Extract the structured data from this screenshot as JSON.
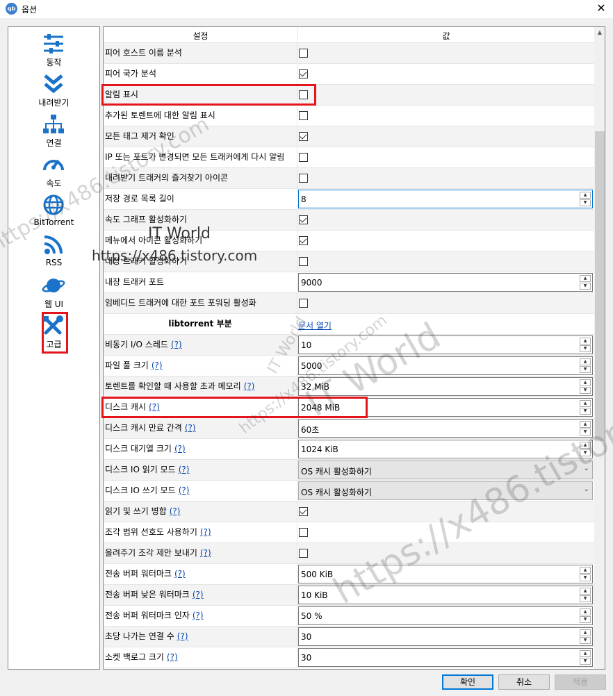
{
  "window": {
    "title": "옵션",
    "app_icon_text": "qb"
  },
  "sidebar": {
    "items": [
      {
        "label": "동작",
        "icon": "sliders-icon"
      },
      {
        "label": "내려받기",
        "icon": "download-chevrons-icon"
      },
      {
        "label": "연결",
        "icon": "network-icon"
      },
      {
        "label": "속도",
        "icon": "speedometer-icon"
      },
      {
        "label": "BitTorrent",
        "icon": "globe-icon"
      },
      {
        "label": "RSS",
        "icon": "rss-icon"
      },
      {
        "label": "웹 UI",
        "icon": "planet-icon"
      },
      {
        "label": "고급",
        "icon": "tools-icon",
        "selected": true
      }
    ]
  },
  "table": {
    "header_setting": "설정",
    "header_value": "값",
    "rows": [
      {
        "label": "피어 호스트 이름 분석",
        "type": "check",
        "checked": false
      },
      {
        "label": "피어 국가 분석",
        "type": "check",
        "checked": true
      },
      {
        "label": "알림 표시",
        "type": "check",
        "checked": false
      },
      {
        "label": "추가된 토렌트에 대한 알림 표시",
        "type": "check",
        "checked": false
      },
      {
        "label": "모든 태그 제거 확인",
        "type": "check",
        "checked": true
      },
      {
        "label": "IP 또는 포트가 변경되면 모든 트래커에게 다시 알림",
        "type": "check",
        "checked": false
      },
      {
        "label": "내려받기 트래커의 즐겨찾기 아이콘",
        "type": "check",
        "checked": false
      },
      {
        "label": "저장 경로 목록 길이",
        "type": "spin",
        "value": "8",
        "focused": true
      },
      {
        "label": "속도 그래프 활성화하기",
        "type": "check",
        "checked": true
      },
      {
        "label": "메뉴에서 아이콘 활성화하기",
        "type": "check",
        "checked": true
      },
      {
        "label": "내장 트래커 활성화하기",
        "type": "check",
        "checked": false
      },
      {
        "label": "내장 트래커 포트",
        "type": "spin",
        "value": "9000"
      },
      {
        "label": "임베디드 트래커에 대한 포트 포워딩 활성화",
        "type": "check",
        "checked": false
      },
      {
        "label": "libtorrent 부분",
        "type": "section",
        "link": "문서 열기"
      },
      {
        "label": "비동기 I/O 스레드",
        "help": "(?)",
        "type": "spin",
        "value": "10"
      },
      {
        "label": "파일 풀 크기",
        "help": "(?)",
        "type": "spin",
        "value": "5000"
      },
      {
        "label": "토렌트를 확인할 때 사용할 초과 메모리",
        "help": "(?)",
        "type": "spin",
        "value": "32 MiB"
      },
      {
        "label": "디스크 캐시",
        "help": "(?)",
        "type": "spin",
        "value": "2048 MiB"
      },
      {
        "label": "디스크 캐시 만료 간격",
        "help": "(?)",
        "type": "spin",
        "value": "60초"
      },
      {
        "label": "디스크 대기열 크기",
        "help": "(?)",
        "type": "spin",
        "value": "1024 KiB"
      },
      {
        "label": "디스크 IO 읽기 모드",
        "help": "(?)",
        "type": "combo",
        "value": "OS 캐시 활성화하기"
      },
      {
        "label": "디스크 IO 쓰기 모드",
        "help": "(?)",
        "type": "combo",
        "value": "OS 캐시 활성화하기"
      },
      {
        "label": "읽기 및 쓰기 병합",
        "help": "(?)",
        "type": "check",
        "checked": true
      },
      {
        "label": "조각 범위 선호도 사용하기",
        "help": "(?)",
        "type": "check",
        "checked": false
      },
      {
        "label": "올려주기 조각 제안 보내기",
        "help": "(?)",
        "type": "check",
        "checked": false
      },
      {
        "label": "전송 버퍼 워터마크",
        "help": "(?)",
        "type": "spin",
        "value": "500 KiB"
      },
      {
        "label": "전송 버퍼 낮은 워터마크",
        "help": "(?)",
        "type": "spin",
        "value": "10 KiB"
      },
      {
        "label": "전송 버퍼 워터마크 인자",
        "help": "(?)",
        "type": "spin",
        "value": "50 %"
      },
      {
        "label": "초당 나가는 연결 수",
        "help": "(?)",
        "type": "spin",
        "value": "30"
      },
      {
        "label": "소켓 백로그 크기",
        "help": "(?)",
        "type": "spin",
        "value": "30"
      }
    ]
  },
  "footer": {
    "ok": "확인",
    "cancel": "취소",
    "apply": "적용"
  },
  "watermark": {
    "line1": "IT World",
    "line2": "https://x486.tistory.com"
  },
  "colors": {
    "highlight": "#e3141b",
    "icon_blue": "#1a73c9",
    "link": "#0645ad"
  }
}
